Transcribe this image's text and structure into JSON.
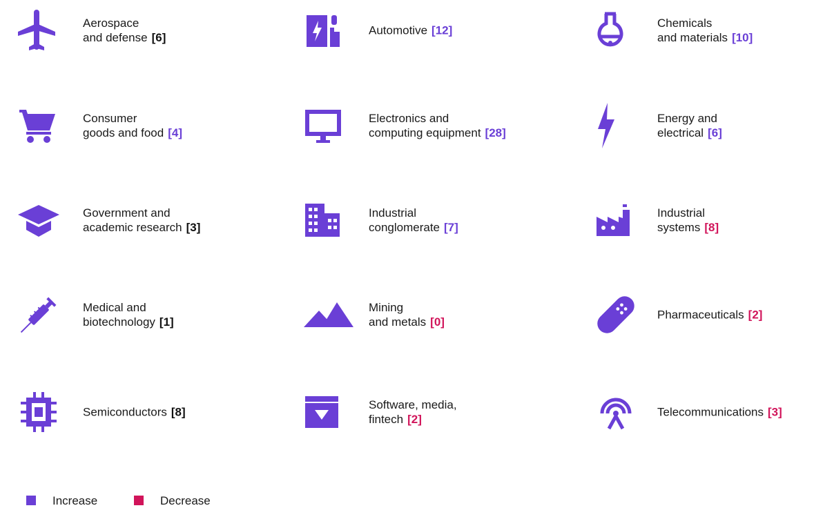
{
  "colors": {
    "icon": "#6a3fd6",
    "increase": "#6a3fd6",
    "decrease": "#d1145a",
    "neutral": "#111111"
  },
  "industries": [
    {
      "icon": "airplane-icon",
      "lines": [
        "Aerospace",
        "and defense"
      ],
      "count": "[6]",
      "trend": "neutral"
    },
    {
      "icon": "ev-charger-icon",
      "lines": [
        "Automotive"
      ],
      "count": "[12]",
      "trend": "increase"
    },
    {
      "icon": "flask-icon",
      "lines": [
        "Chemicals",
        "and materials"
      ],
      "count": "[10]",
      "trend": "increase"
    },
    {
      "icon": "shopping-cart-icon",
      "lines": [
        "Consumer",
        "goods and food"
      ],
      "count": "[4]",
      "trend": "increase"
    },
    {
      "icon": "monitor-icon",
      "lines": [
        "Electronics and",
        "computing equipment"
      ],
      "count": "[28]",
      "trend": "increase"
    },
    {
      "icon": "lightning-bolt-icon",
      "lines": [
        "Energy and",
        "electrical"
      ],
      "count": "[6]",
      "trend": "increase"
    },
    {
      "icon": "graduation-cap-icon",
      "lines": [
        "Government and",
        "academic research"
      ],
      "count": "[3]",
      "trend": "neutral"
    },
    {
      "icon": "office-building-icon",
      "lines": [
        "Industrial",
        "conglomerate"
      ],
      "count": "[7]",
      "trend": "increase"
    },
    {
      "icon": "factory-icon",
      "lines": [
        "Industrial",
        "systems"
      ],
      "count": "[8]",
      "trend": "decrease"
    },
    {
      "icon": "syringe-icon",
      "lines": [
        "Medical and",
        "biotechnology"
      ],
      "count": "[1]",
      "trend": "neutral"
    },
    {
      "icon": "mountains-icon",
      "lines": [
        "Mining",
        "and metals"
      ],
      "count": "[0]",
      "trend": "decrease"
    },
    {
      "icon": "bandage-icon",
      "lines": [
        "Pharmaceuticals"
      ],
      "count": "[2]",
      "trend": "decrease"
    },
    {
      "icon": "chip-icon",
      "lines": [
        "Semiconductors"
      ],
      "count": "[8]",
      "trend": "neutral"
    },
    {
      "icon": "archive-box-icon",
      "lines": [
        "Software, media,",
        "fintech"
      ],
      "count": "[2]",
      "trend": "decrease"
    },
    {
      "icon": "antenna-icon",
      "lines": [
        "Telecommunications"
      ],
      "count": "[3]",
      "trend": "decrease"
    }
  ],
  "legend": {
    "increase_label": "Increase",
    "decrease_label": "Decrease"
  }
}
